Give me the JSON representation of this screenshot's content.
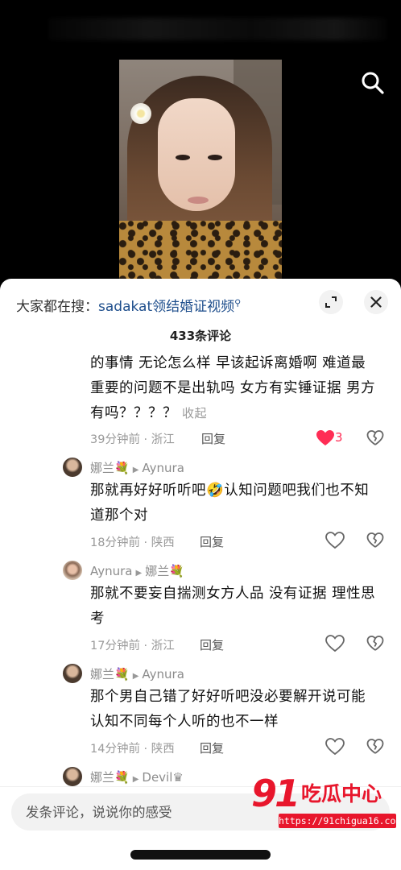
{
  "sheet": {
    "search_prefix": "大家都在搜：",
    "search_keyword": "sadakat领结婚证视频",
    "comment_count": "433条评论"
  },
  "comments": [
    {
      "text_lines": [
        "的事情 无论怎么样 早该起诉离婚啊 难道最",
        "重要的问题不是出轨吗 女方有实锤证据 男方",
        "有吗？？？？"
      ],
      "collapse_label": "收起",
      "time_location": "39分钟前 · 浙江",
      "reply_label": "回复",
      "like_count": "3",
      "liked": true
    },
    {
      "author": "娜兰💐",
      "reply_to": "Aynura",
      "text_lines": [
        "那就再好好听听吧🤣认知问题吧我们也不知",
        "道那个对"
      ],
      "time_location": "18分钟前 · 陕西",
      "reply_label": "回复"
    },
    {
      "author": "Aynura",
      "reply_to": "娜兰💐",
      "text_lines": [
        "那就不要妄自揣测女方人品 没有证据 理性思",
        "考"
      ],
      "time_location": "17分钟前 · 浙江",
      "reply_label": "回复"
    },
    {
      "author": "娜兰💐",
      "reply_to": "Aynura",
      "text_lines": [
        "那个男自己错了好好听吧没必要解开说可能",
        "认知不同每个人听的也不一样"
      ],
      "time_location": "14分钟前 · 陕西",
      "reply_label": "回复"
    },
    {
      "author": "娜兰💐",
      "reply_to": "Devil♛"
    }
  ],
  "input": {
    "placeholder": "发条评论，说说你的感受"
  },
  "watermark": {
    "number": "91",
    "title": "吃瓜中心",
    "url": "https://91chigua16.com"
  },
  "colors": {
    "like_red": "#ff2d55",
    "keyword_blue": "#1e4e8c",
    "watermark_red": "#e8162c"
  },
  "icons": [
    "search-icon",
    "expand-icon",
    "close-icon",
    "heart-icon",
    "broken-heart-icon"
  ]
}
